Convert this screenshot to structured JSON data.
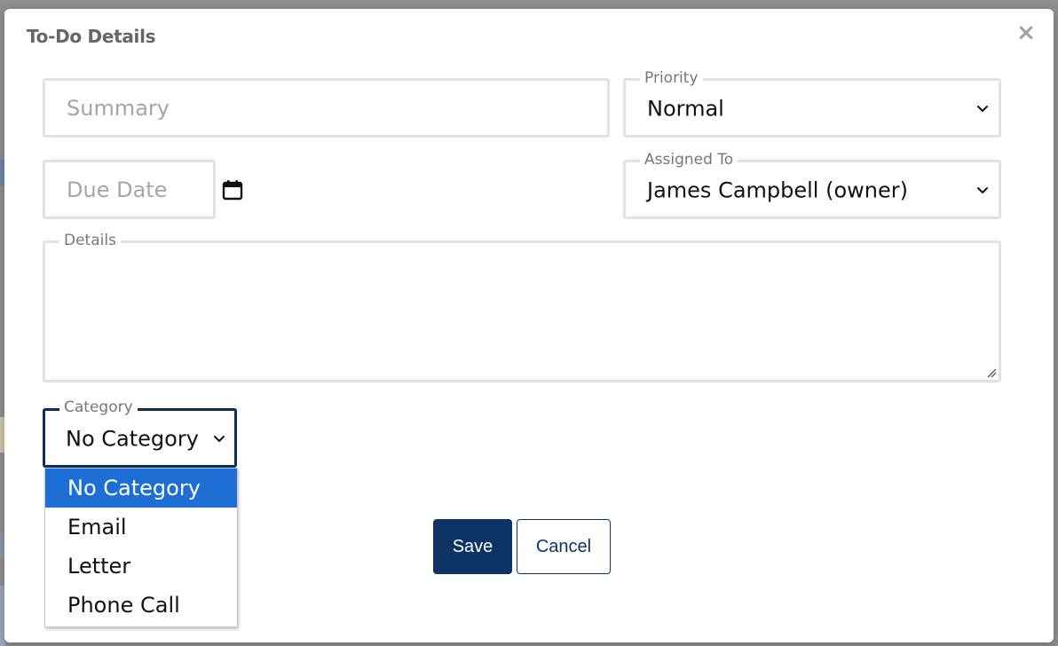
{
  "dialog": {
    "title": "To-Do Details",
    "close_label": "×"
  },
  "fields": {
    "summary": {
      "placeholder": "Summary",
      "value": ""
    },
    "priority": {
      "label": "Priority",
      "value": "Normal"
    },
    "due_date": {
      "placeholder": "Due Date",
      "value": ""
    },
    "assigned_to": {
      "label": "Assigned To",
      "value": "James Campbell (owner)"
    },
    "details": {
      "label": "Details",
      "value": ""
    },
    "category": {
      "label": "Category",
      "value": "No Category",
      "options": [
        "No Category",
        "Email",
        "Letter",
        "Phone Call"
      ],
      "highlighted": "No Category"
    }
  },
  "buttons": {
    "save_label": "Save",
    "cancel_label": "Cancel"
  },
  "colors": {
    "primary": "#0c3363",
    "highlight": "#1d6fd6",
    "border": "#e2e2e2"
  },
  "icons": {
    "calendar": "calendar-icon",
    "close": "close-icon",
    "chevron": "chevron-down-icon"
  }
}
